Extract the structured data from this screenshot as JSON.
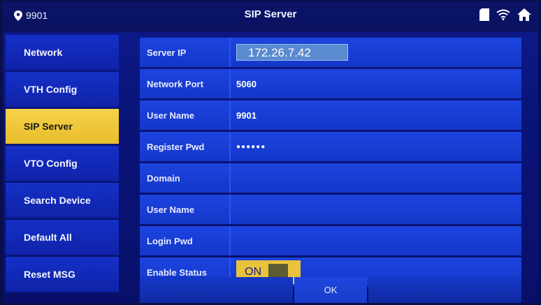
{
  "topbar": {
    "location_number": "9901",
    "title": "SIP Server"
  },
  "sidebar": {
    "items": [
      {
        "label": "Network"
      },
      {
        "label": "VTH Config"
      },
      {
        "label": "SIP Server"
      },
      {
        "label": "VTO Config"
      },
      {
        "label": "Search Device"
      },
      {
        "label": "Default All"
      },
      {
        "label": "Reset MSG"
      }
    ],
    "active_index": 2
  },
  "form": {
    "server_ip": {
      "label": "Server IP",
      "value": "172.26.7.42"
    },
    "network_port": {
      "label": "Network Port",
      "value": "5060"
    },
    "user_name": {
      "label": "User Name",
      "value": "9901"
    },
    "register_pwd": {
      "label": "Register Pwd",
      "value": "●●●●●●"
    },
    "domain": {
      "label": "Domain",
      "value": ""
    },
    "user_name_2": {
      "label": "User Name",
      "value": ""
    },
    "login_pwd": {
      "label": "Login Pwd",
      "value": ""
    },
    "enable_status": {
      "label": "Enable Status",
      "value": "ON"
    }
  },
  "buttons": {
    "ok_label": "OK"
  },
  "colors": {
    "accent": "#e8c43c",
    "field_bg": "#1437c8",
    "background": "#0a1478"
  },
  "icons": [
    "location-pin-icon",
    "sd-card-icon",
    "wifi-icon",
    "home-icon"
  ]
}
